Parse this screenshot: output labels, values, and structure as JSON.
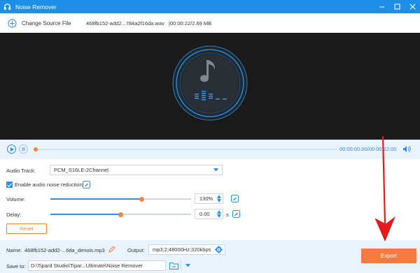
{
  "app": {
    "title": "Noise Remover"
  },
  "toolbar": {
    "change_source_label": "Change Source File",
    "file_name": "468fb152-add2...784a2f16da.wav",
    "file_info": "|00:00:22/2.69 MB"
  },
  "player": {
    "timecode": "00:00:00.00/00:00:22.00",
    "progress": 0
  },
  "settings": {
    "audio_track_label": "Audio Track:",
    "audio_track_value": "PCM_S16LE-2Channel",
    "noise_reduction_label": "Enable audio noise reduction",
    "noise_reduction_checked": true,
    "volume_label": "Volume:",
    "volume_value": "130%",
    "volume_level": 0.65,
    "delay_label": "Delay:",
    "delay_value": "0.00",
    "delay_unit": "s",
    "delay_level": 0.5,
    "reset_label": "Reset"
  },
  "footer": {
    "name_label": "Name:",
    "name_value": "468fb152-add2-...6da_denois.mp3",
    "output_label": "Output:",
    "output_value": "mp3;2;48000Hz;320kbps",
    "save_label": "Save to:",
    "save_value": "D:\\Tipard Studio\\Tipar...Ultimate\\Noise Remover",
    "export_label": "Export"
  },
  "colors": {
    "accent": "#1e8fe6",
    "orange": "#f47b40",
    "annotation_arrow": "#e8191c"
  },
  "icons": [
    "headphones-icon",
    "minimize-icon",
    "maximize-icon",
    "close-icon",
    "add-icon",
    "music-note-icon",
    "play-icon",
    "stop-icon",
    "volume-icon",
    "edit-icon",
    "settings-icon",
    "folder-icon",
    "chevron-down-icon"
  ]
}
